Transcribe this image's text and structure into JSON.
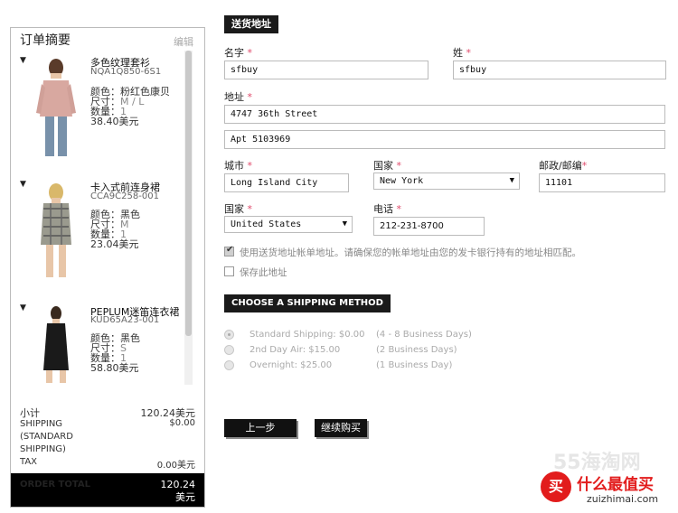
{
  "summary": {
    "title": "订单摘要",
    "edit_label": "编辑",
    "items": [
      {
        "name": "多色纹理套衫",
        "sku": "NQA1Q850-6S1",
        "color_label": "颜色：",
        "color": "粉红色康贝",
        "size_label": "尺寸：",
        "size": "M / L",
        "qty_label": "数量：",
        "qty": "1",
        "price": "38.40美元"
      },
      {
        "name": "卡入式前连身裙",
        "sku": "CCA9C258-001",
        "color_label": "颜色：",
        "color": "黑色",
        "size_label": "尺寸：",
        "size": "M",
        "qty_label": "数量：",
        "qty": "1",
        "price": "23.04美元"
      },
      {
        "name": "PEPLUM迷笛连衣裙",
        "sku": "KUD65A23-001",
        "color_label": "颜色：",
        "color": "黑色",
        "size_label": "尺寸：",
        "size": "S",
        "qty_label": "数量：",
        "qty": "1",
        "price": "58.80美元"
      }
    ],
    "subtotal_label": "小计",
    "subtotal": "120.24美元",
    "shipping_label_1": "SHIPPING",
    "shipping_label_2": "(STANDARD",
    "shipping_label_3": "SHIPPING)",
    "shipping": "$0.00",
    "tax_label": "TAX",
    "tax": "0.00美元",
    "order_total_label": "ORDER TOTAL",
    "order_total_1": "120.24",
    "order_total_2": "美元"
  },
  "form": {
    "section_title": "送货地址",
    "first_name_label": "名字",
    "first_name": "sfbuy",
    "last_name_label": "姓",
    "last_name": "sfbuy",
    "address_label": "地址",
    "address1": "4747 36th Street",
    "address2": "Apt 5103969",
    "city_label": "城市",
    "city": "Long Island City",
    "state_label": "国家",
    "state": "New York",
    "zip_label": "邮政/邮编",
    "zip": "11101",
    "country_label": "国家",
    "country": "United States",
    "phone_label": "电话",
    "phone": "212-231-8700",
    "required_mark": "*",
    "billing_same": "使用送货地址帐单地址。请确保您的帐单地址由您的发卡银行持有的地址相匹配。",
    "save_address": "保存此地址"
  },
  "shipping_method": {
    "title": "CHOOSE A SHIPPING METHOD",
    "options": [
      {
        "label": "Standard Shipping: $0.00",
        "days": "(4 - 8 Business Days)",
        "selected": true
      },
      {
        "label": "2nd Day Air: $15.00",
        "days": "(2 Business Days)",
        "selected": false
      },
      {
        "label": "Overnight: $25.00",
        "days": "(1 Business Day)",
        "selected": false
      }
    ]
  },
  "buttons": {
    "back": "上一步",
    "continue": "继续购买"
  },
  "watermark": {
    "site": "55海淘网",
    "logo_char": "买",
    "brand": "什么最值买",
    "url": "zuizhimai.com"
  },
  "colors": {
    "required": "#e04a6b",
    "dark": "#111111"
  }
}
